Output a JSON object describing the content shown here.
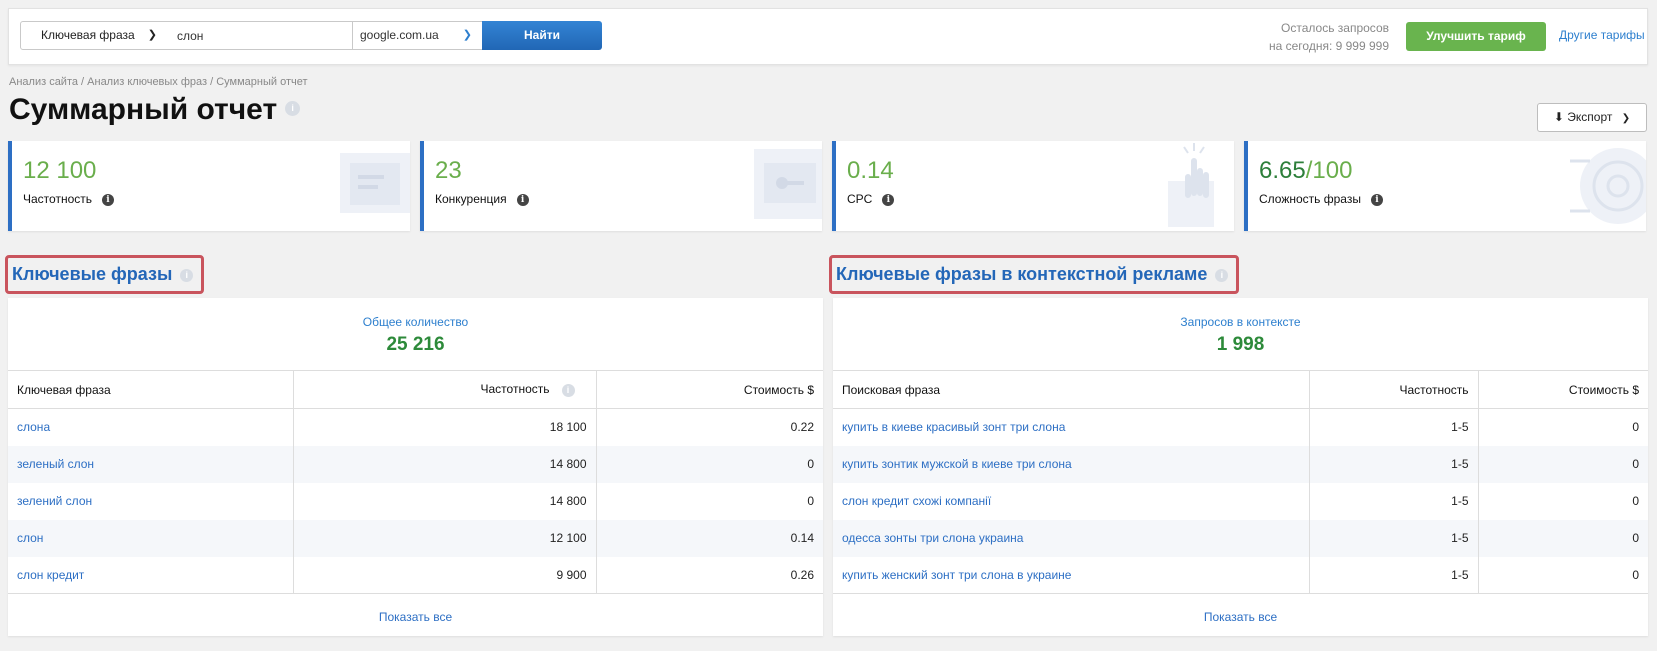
{
  "search": {
    "type_label": "Ключевая фраза",
    "query": "слон",
    "engine": "google.com.ua",
    "find_label": "Найти"
  },
  "limit": {
    "line1": "Осталось запросов",
    "line2": "на сегодня: 9 999 999"
  },
  "upgrade_label": "Улучшить тариф",
  "other_plans_label": "Другие тарифы",
  "breadcrumb": "Анализ сайта / Анализ ключевых фраз / Суммарный отчет",
  "page_title": "Суммарный отчет",
  "export_label": "Экспорт",
  "metrics": [
    {
      "value": "12 100",
      "label": "Частотность"
    },
    {
      "value": "23",
      "label": "Конкуренция"
    },
    {
      "value": "0.14",
      "label": "CPC"
    },
    {
      "value": "6.65",
      "value_suffix": "/100",
      "label": "Сложность фразы"
    }
  ],
  "keywords": {
    "heading": "Ключевые фразы",
    "total_label": "Общее количество",
    "total_value": "25 216",
    "columns": [
      "Ключевая фраза",
      "Частотность",
      "Стоимость $"
    ],
    "rows": [
      {
        "phrase": "слона",
        "freq": "18 100",
        "cost": "0.22"
      },
      {
        "phrase": "зеленый слон",
        "freq": "14 800",
        "cost": "0"
      },
      {
        "phrase": "зелений слон",
        "freq": "14 800",
        "cost": "0"
      },
      {
        "phrase": "слон",
        "freq": "12 100",
        "cost": "0.14"
      },
      {
        "phrase": "слон кредит",
        "freq": "9 900",
        "cost": "0.26"
      }
    ],
    "show_all": "Показать все"
  },
  "context": {
    "heading": "Ключевые фразы в контекстной рекламе",
    "total_label": "Запросов в контексте",
    "total_value": "1 998",
    "columns": [
      "Поисковая фраза",
      "Частотность",
      "Стоимость $"
    ],
    "rows": [
      {
        "phrase": "купить в киеве красивый зонт три слона",
        "freq": "1-5",
        "cost": "0"
      },
      {
        "phrase": "купить зонтик мужской в киеве три слона",
        "freq": "1-5",
        "cost": "0"
      },
      {
        "phrase": "слон кредит схожі компанії",
        "freq": "1-5",
        "cost": "0"
      },
      {
        "phrase": "одесса зонты три слона украина",
        "freq": "1-5",
        "cost": "0"
      },
      {
        "phrase": "купить женский зонт три слона в украине",
        "freq": "1-5",
        "cost": "0"
      }
    ],
    "show_all": "Показать все"
  },
  "colors": {
    "accent_blue": "#2d6fc4",
    "value_green": "#6aae4c",
    "highlight_red": "#c9545d",
    "upgrade_green": "#69b44e"
  }
}
